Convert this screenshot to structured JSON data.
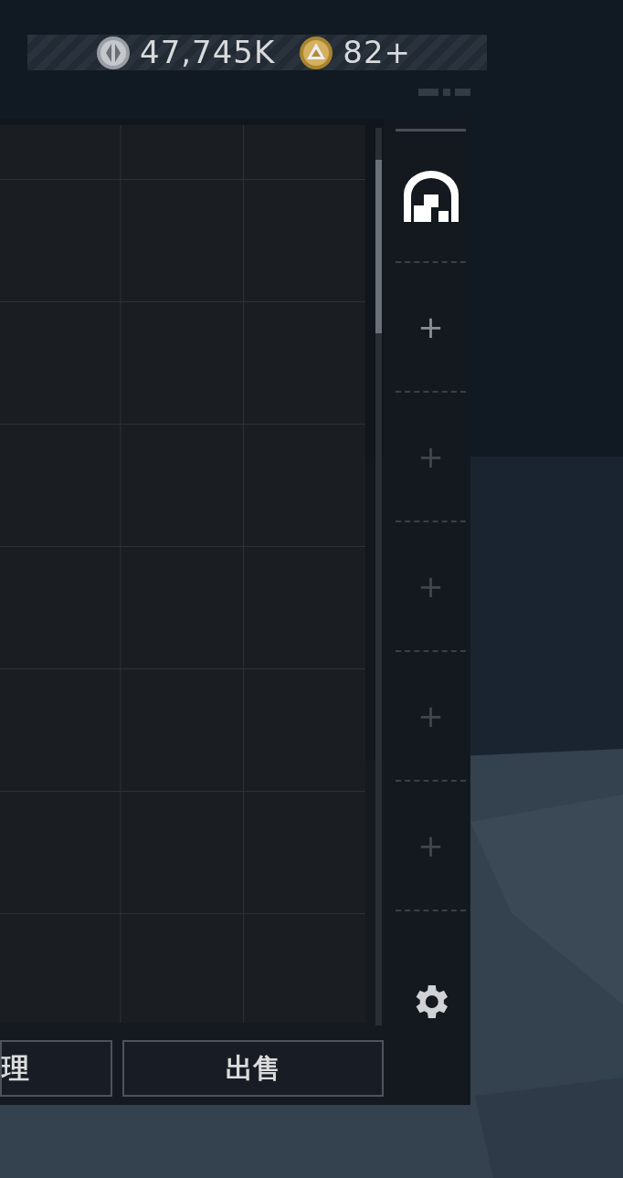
{
  "currencies": [
    {
      "kind": "silver",
      "amount": "47,745K"
    },
    {
      "kind": "gold",
      "amount": "82+"
    }
  ],
  "sidebar": {
    "slots": [
      {
        "kind": "equipped"
      },
      {
        "kind": "add",
        "label": "+",
        "disabled": false
      },
      {
        "kind": "add",
        "label": "+",
        "disabled": true
      },
      {
        "kind": "add",
        "label": "+",
        "disabled": true
      },
      {
        "kind": "add",
        "label": "+",
        "disabled": true
      },
      {
        "kind": "add",
        "label": "+",
        "disabled": true
      }
    ]
  },
  "buttons": [
    "理",
    "出售"
  ]
}
